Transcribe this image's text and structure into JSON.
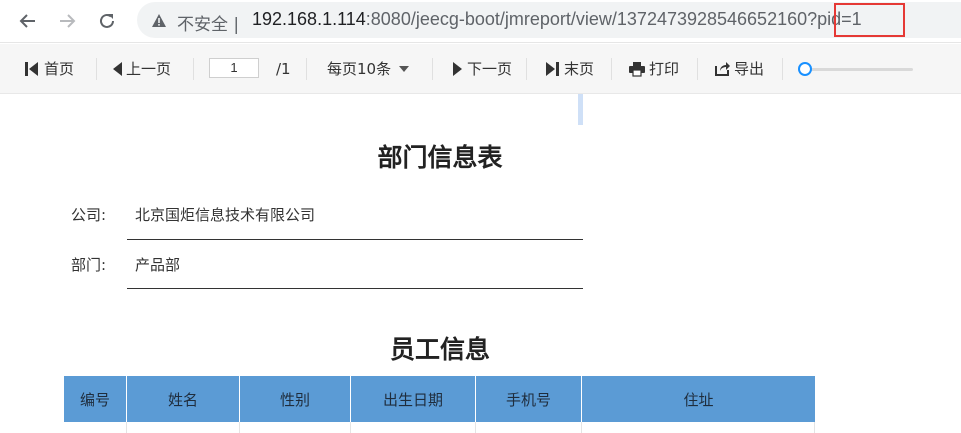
{
  "browser": {
    "security_label": "不安全",
    "url_host": "192.168.1.114",
    "url_rest": ":8080/jeecg-boot/jmreport/view/1372473928546652160?pid=1"
  },
  "toolbar": {
    "first_page": "首页",
    "prev_page": "上一页",
    "page_current": "1",
    "page_total": "/1",
    "page_size": "每页10条",
    "next_page": "下一页",
    "last_page": "末页",
    "print": "打印",
    "export": "导出"
  },
  "report": {
    "title": "部门信息表",
    "company_label": "公司:",
    "company_value": "北京国炬信息技术有限公司",
    "dept_label": "部门:",
    "dept_value": "产品部",
    "section_title": "员工信息",
    "columns": [
      "编号",
      "姓名",
      "性别",
      "出生日期",
      "手机号",
      "住址"
    ]
  },
  "colors": {
    "header_blue": "#5b9bd5",
    "highlight_red": "#e53935",
    "slider_blue": "#1890ff"
  }
}
